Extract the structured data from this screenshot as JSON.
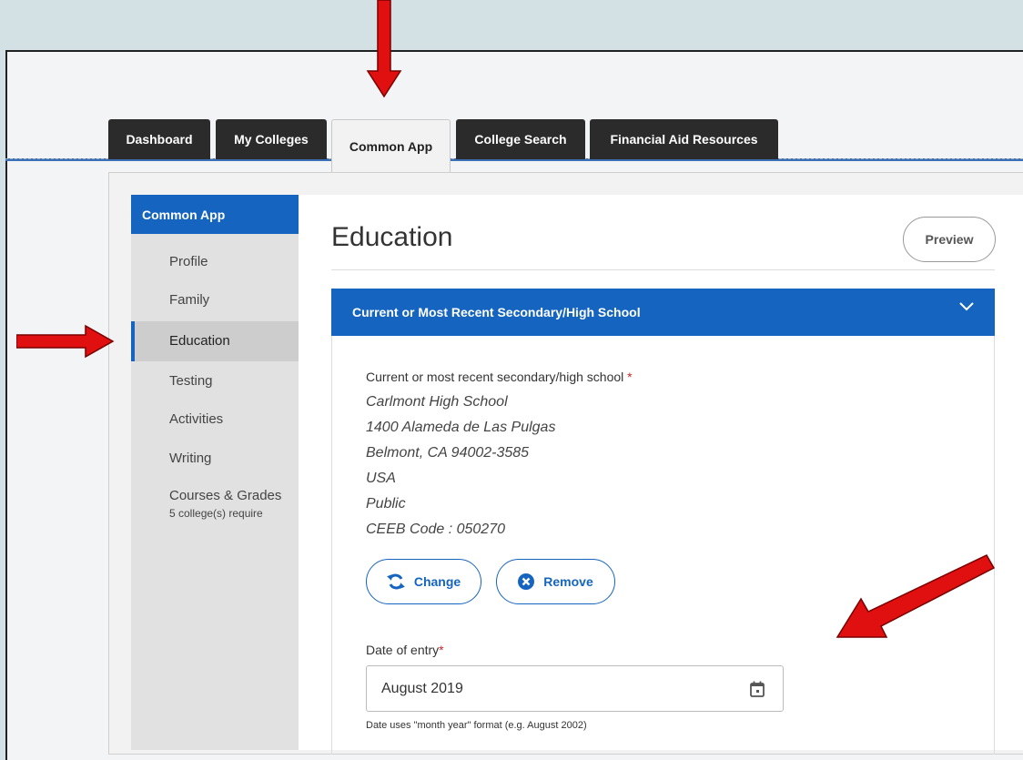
{
  "tabs": [
    "Dashboard",
    "My Colleges",
    "Common App",
    "College Search",
    "Financial Aid Resources"
  ],
  "active_tab": "Common App",
  "sidebar": {
    "header": "Common App",
    "items": [
      {
        "label": "Profile"
      },
      {
        "label": "Family"
      },
      {
        "label": "Education"
      },
      {
        "label": "Testing"
      },
      {
        "label": "Activities"
      },
      {
        "label": "Writing"
      },
      {
        "label": "Courses & Grades",
        "sublabel": "5 college(s) require"
      }
    ],
    "active_item": "Education"
  },
  "page": {
    "title": "Education",
    "preview_label": "Preview"
  },
  "section": {
    "title": "Current or Most Recent Secondary/High School",
    "chevron_icon": "chevron-down-icon",
    "school_label": "Current or most recent secondary/high school",
    "required_mark": "*",
    "school_lines": [
      "Carlmont High School",
      "1400 Alameda de Las Pulgas",
      "Belmont, CA 94002-3585",
      "USA",
      "Public",
      "CEEB Code : 050270"
    ],
    "change_label": "Change",
    "change_icon": "refresh-icon",
    "remove_label": "Remove",
    "remove_icon": "close-circle-icon",
    "date_label": "Date of entry",
    "date_value": "August 2019",
    "date_icon": "calendar-icon",
    "date_hint": "Date uses \"month year\" format (e.g. August 2002)"
  },
  "colors": {
    "brand_blue": "#1565c0",
    "tab_dark": "#2b2b2b",
    "annotation_red": "#e01010",
    "background": "#d4e1e4"
  }
}
